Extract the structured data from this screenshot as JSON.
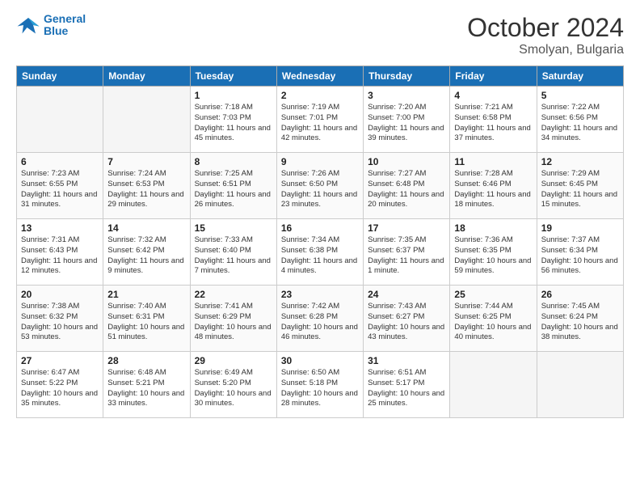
{
  "header": {
    "logo_line1": "General",
    "logo_line2": "Blue",
    "month": "October 2024",
    "location": "Smolyan, Bulgaria"
  },
  "weekdays": [
    "Sunday",
    "Monday",
    "Tuesday",
    "Wednesday",
    "Thursday",
    "Friday",
    "Saturday"
  ],
  "weeks": [
    [
      {
        "day": "",
        "info": ""
      },
      {
        "day": "",
        "info": ""
      },
      {
        "day": "1",
        "info": "Sunrise: 7:18 AM\nSunset: 7:03 PM\nDaylight: 11 hours and 45 minutes."
      },
      {
        "day": "2",
        "info": "Sunrise: 7:19 AM\nSunset: 7:01 PM\nDaylight: 11 hours and 42 minutes."
      },
      {
        "day": "3",
        "info": "Sunrise: 7:20 AM\nSunset: 7:00 PM\nDaylight: 11 hours and 39 minutes."
      },
      {
        "day": "4",
        "info": "Sunrise: 7:21 AM\nSunset: 6:58 PM\nDaylight: 11 hours and 37 minutes."
      },
      {
        "day": "5",
        "info": "Sunrise: 7:22 AM\nSunset: 6:56 PM\nDaylight: 11 hours and 34 minutes."
      }
    ],
    [
      {
        "day": "6",
        "info": "Sunrise: 7:23 AM\nSunset: 6:55 PM\nDaylight: 11 hours and 31 minutes."
      },
      {
        "day": "7",
        "info": "Sunrise: 7:24 AM\nSunset: 6:53 PM\nDaylight: 11 hours and 29 minutes."
      },
      {
        "day": "8",
        "info": "Sunrise: 7:25 AM\nSunset: 6:51 PM\nDaylight: 11 hours and 26 minutes."
      },
      {
        "day": "9",
        "info": "Sunrise: 7:26 AM\nSunset: 6:50 PM\nDaylight: 11 hours and 23 minutes."
      },
      {
        "day": "10",
        "info": "Sunrise: 7:27 AM\nSunset: 6:48 PM\nDaylight: 11 hours and 20 minutes."
      },
      {
        "day": "11",
        "info": "Sunrise: 7:28 AM\nSunset: 6:46 PM\nDaylight: 11 hours and 18 minutes."
      },
      {
        "day": "12",
        "info": "Sunrise: 7:29 AM\nSunset: 6:45 PM\nDaylight: 11 hours and 15 minutes."
      }
    ],
    [
      {
        "day": "13",
        "info": "Sunrise: 7:31 AM\nSunset: 6:43 PM\nDaylight: 11 hours and 12 minutes."
      },
      {
        "day": "14",
        "info": "Sunrise: 7:32 AM\nSunset: 6:42 PM\nDaylight: 11 hours and 9 minutes."
      },
      {
        "day": "15",
        "info": "Sunrise: 7:33 AM\nSunset: 6:40 PM\nDaylight: 11 hours and 7 minutes."
      },
      {
        "day": "16",
        "info": "Sunrise: 7:34 AM\nSunset: 6:38 PM\nDaylight: 11 hours and 4 minutes."
      },
      {
        "day": "17",
        "info": "Sunrise: 7:35 AM\nSunset: 6:37 PM\nDaylight: 11 hours and 1 minute."
      },
      {
        "day": "18",
        "info": "Sunrise: 7:36 AM\nSunset: 6:35 PM\nDaylight: 10 hours and 59 minutes."
      },
      {
        "day": "19",
        "info": "Sunrise: 7:37 AM\nSunset: 6:34 PM\nDaylight: 10 hours and 56 minutes."
      }
    ],
    [
      {
        "day": "20",
        "info": "Sunrise: 7:38 AM\nSunset: 6:32 PM\nDaylight: 10 hours and 53 minutes."
      },
      {
        "day": "21",
        "info": "Sunrise: 7:40 AM\nSunset: 6:31 PM\nDaylight: 10 hours and 51 minutes."
      },
      {
        "day": "22",
        "info": "Sunrise: 7:41 AM\nSunset: 6:29 PM\nDaylight: 10 hours and 48 minutes."
      },
      {
        "day": "23",
        "info": "Sunrise: 7:42 AM\nSunset: 6:28 PM\nDaylight: 10 hours and 46 minutes."
      },
      {
        "day": "24",
        "info": "Sunrise: 7:43 AM\nSunset: 6:27 PM\nDaylight: 10 hours and 43 minutes."
      },
      {
        "day": "25",
        "info": "Sunrise: 7:44 AM\nSunset: 6:25 PM\nDaylight: 10 hours and 40 minutes."
      },
      {
        "day": "26",
        "info": "Sunrise: 7:45 AM\nSunset: 6:24 PM\nDaylight: 10 hours and 38 minutes."
      }
    ],
    [
      {
        "day": "27",
        "info": "Sunrise: 6:47 AM\nSunset: 5:22 PM\nDaylight: 10 hours and 35 minutes."
      },
      {
        "day": "28",
        "info": "Sunrise: 6:48 AM\nSunset: 5:21 PM\nDaylight: 10 hours and 33 minutes."
      },
      {
        "day": "29",
        "info": "Sunrise: 6:49 AM\nSunset: 5:20 PM\nDaylight: 10 hours and 30 minutes."
      },
      {
        "day": "30",
        "info": "Sunrise: 6:50 AM\nSunset: 5:18 PM\nDaylight: 10 hours and 28 minutes."
      },
      {
        "day": "31",
        "info": "Sunrise: 6:51 AM\nSunset: 5:17 PM\nDaylight: 10 hours and 25 minutes."
      },
      {
        "day": "",
        "info": ""
      },
      {
        "day": "",
        "info": ""
      }
    ]
  ]
}
